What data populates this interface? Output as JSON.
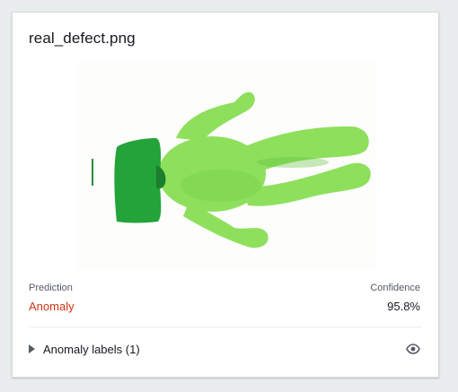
{
  "card": {
    "title": "real_defect.png"
  },
  "image": {
    "subject": "green plastic figure with a highlighted anomaly region",
    "colors": {
      "figure": "#8ee05c",
      "figure_shadow": "#5fbe3a",
      "anomaly_overlay": "#23a33a",
      "background": "#fdfdfb"
    }
  },
  "result": {
    "prediction_label": "Prediction",
    "prediction_value": "Anomaly",
    "confidence_label": "Confidence",
    "confidence_value": "95.8%",
    "prediction_color": "#d13212"
  },
  "labels_section": {
    "toggle_label": "Anomaly labels (1)",
    "toggle_icon": "caret-right-icon",
    "visibility_icon": "eye-icon"
  }
}
